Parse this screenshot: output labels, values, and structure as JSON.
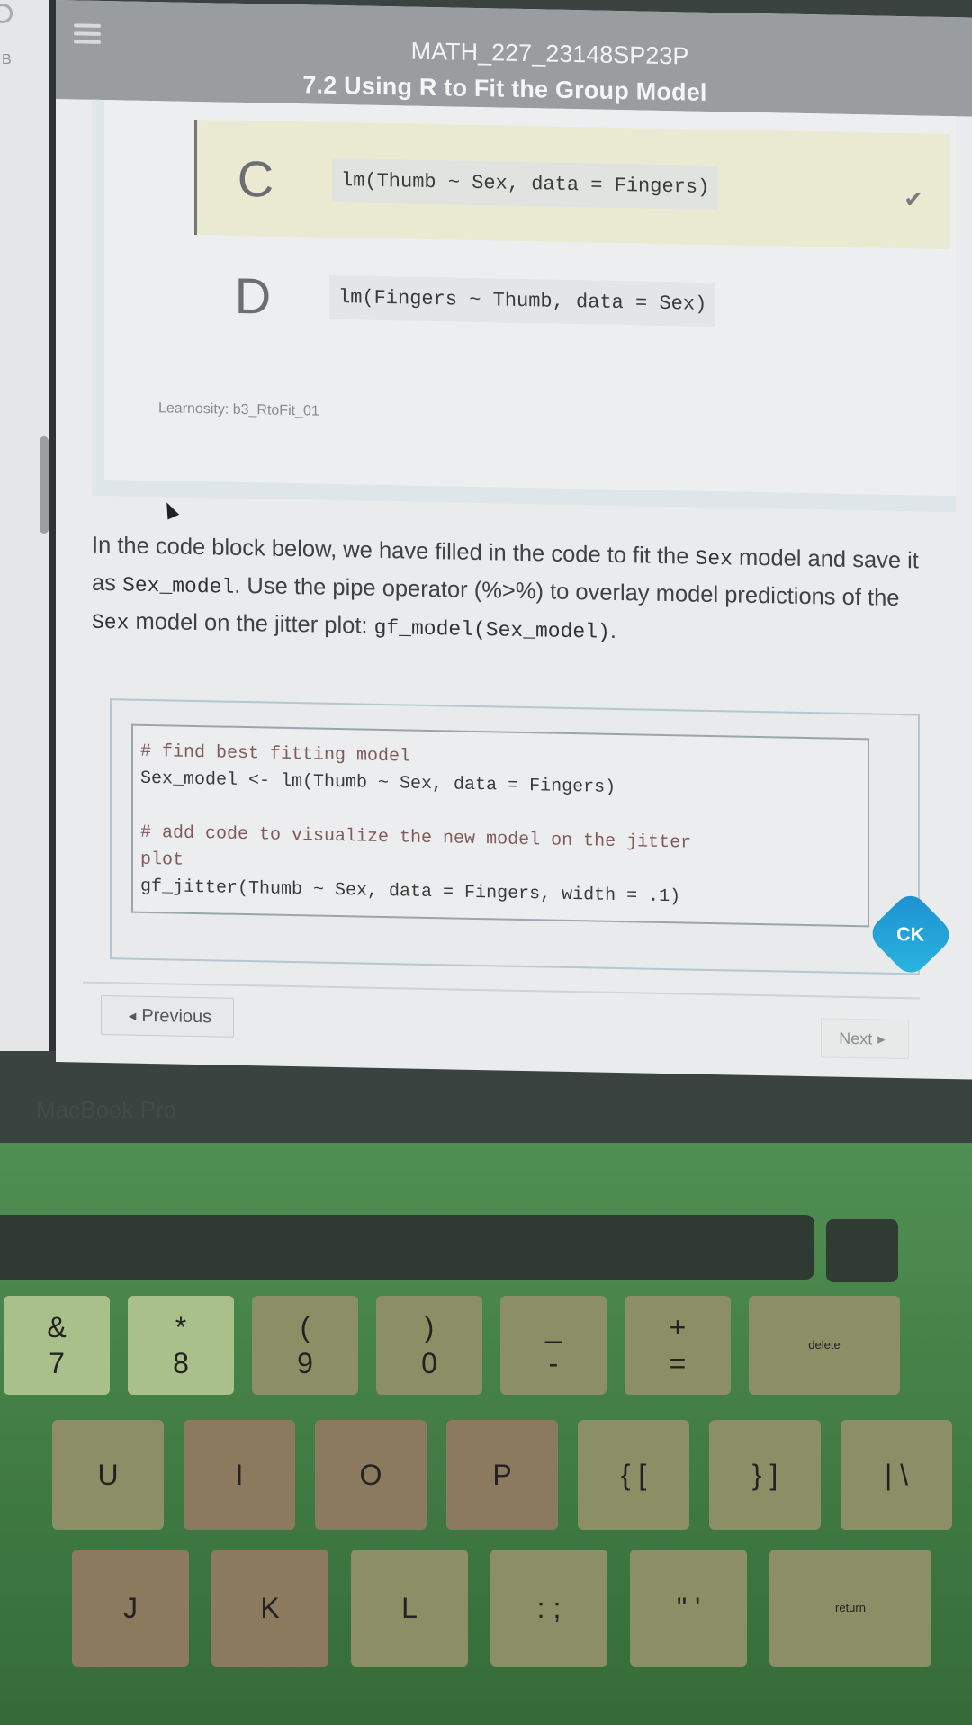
{
  "left_window": {
    "label": "B"
  },
  "header": {
    "course_code": "MATH_227_23148SP23P",
    "lesson_title": "7.2 Using R to Fit the Group Model"
  },
  "question": {
    "options": [
      {
        "letter": "C",
        "code": "lm(Thumb ~ Sex, data = Fingers)",
        "selected": true,
        "correct": true
      },
      {
        "letter": "D",
        "code": "lm(Fingers ~ Thumb, data = Sex)",
        "selected": false,
        "correct": false
      }
    ],
    "source_label": "Learnosity: b3_RtoFit_01"
  },
  "instruction": {
    "part1": "In the code block below, we have filled in the code to fit the ",
    "code1": "Sex",
    "part2": " model and save it as ",
    "code2": "Sex_model",
    "part3": ". Use the pipe operator (%>%) to overlay model predictions of the ",
    "code3": "Sex",
    "part4": " model on the jitter plot: ",
    "code4": "gf_model(Sex_model)",
    "part5": "."
  },
  "editor": {
    "lines": [
      "# find best fitting model",
      "Sex_model <- lm(Thumb ~ Sex, data = Fingers)",
      "",
      "# add code to visualize the new model on the jitter",
      "plot",
      "gf_jitter(Thumb ~ Sex, data = Fingers, width = .1)"
    ]
  },
  "ck_button": {
    "label": "CK"
  },
  "navigation": {
    "previous_label": "Previous",
    "next_label": "Next"
  },
  "keyboard": {
    "row1": [
      {
        "top": "&",
        "bottom": "7"
      },
      {
        "top": "*",
        "bottom": "8"
      },
      {
        "top": "(",
        "bottom": "9"
      },
      {
        "top": ")",
        "bottom": "0"
      },
      {
        "top": "_",
        "bottom": "-"
      },
      {
        "top": "+",
        "bottom": "="
      },
      {
        "top": "",
        "bottom": "delete"
      }
    ],
    "row2": [
      "U",
      "I",
      "O",
      "P",
      "{ [",
      "} ]",
      "| \\"
    ],
    "row3": [
      "J",
      "K",
      "L",
      ": ;",
      "\" '",
      "return"
    ]
  }
}
